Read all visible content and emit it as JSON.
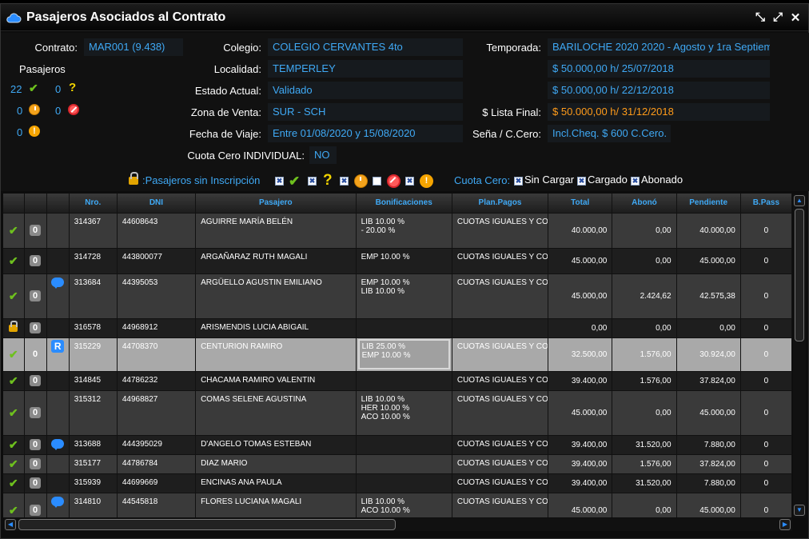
{
  "window": {
    "title": "Pasajeros Asociados al Contrato"
  },
  "info": {
    "contrato_label": "Contrato:",
    "contrato": "MAR001 (9.438)",
    "colegio_label": "Colegio:",
    "colegio": "COLEGIO CERVANTES 4to",
    "localidad_label": "Localidad:",
    "localidad": "TEMPERLEY",
    "estado_label": "Estado Actual:",
    "estado": "Validado",
    "zona_label": "Zona de Venta:",
    "zona": "SUR - SCH",
    "fecha_label": "Fecha de Viaje:",
    "fecha": "Entre 01/08/2020 y 15/08/2020",
    "cuota_label": "Cuota Cero INDIVIDUAL:",
    "cuota": "NO",
    "temporada_label": "Temporada:",
    "temporada": "BARILOCHE 2020 2020 - Agosto y 1ra Septiem",
    "precio1": "$ 50.000,00 h/ 25/07/2018",
    "precio2": "$ 50.000,00 h/ 22/12/2018",
    "lista_label": "$ Lista Final:",
    "lista": "$ 50.000,00 h/ 31/12/2018",
    "sena_label": "Seña / C.Cero:",
    "sena": "Incl.Cheq. $ 600 C.Cero."
  },
  "pasajeros": {
    "label": "Pasajeros",
    "ok": "22",
    "pending": "0",
    "clock": "0",
    "banned": "0",
    "warn": "0"
  },
  "legend": {
    "sin_inscripcion": ":Pasajeros sin Inscripción",
    "cuota_cero": "Cuota Cero:",
    "sin_cargar": "Sin Cargar",
    "cargado": "Cargado",
    "abonado": "Abonado"
  },
  "columns": [
    "",
    "",
    "",
    "Nro.",
    "DNI",
    "Pasajero",
    "Bonificaciones",
    "Plan.Pagos",
    "Total",
    "Abonó",
    "Pendiente",
    "B.Pass"
  ],
  "rows": [
    {
      "status": "check",
      "badge": "0",
      "extra": "",
      "nro": "314367",
      "dni": "44608643",
      "nombre": "AGUIRRE MARÍA BELÉN",
      "bonif": [
        "LIB 10.00 %",
        "- 20.00 %"
      ],
      "plan": "CUOTAS IGUALES Y COI",
      "total": "40.000,00",
      "abono": "0,00",
      "pend": "40.000,00",
      "bpass": "0"
    },
    {
      "status": "check",
      "badge": "0",
      "extra": "",
      "nro": "314728",
      "dni": "443800077",
      "nombre": "ARGAÑARAZ RUTH MAGALI",
      "bonif": [
        "EMP 10.00 %"
      ],
      "plan": "CUOTAS IGUALES Y COI",
      "total": "45.000,00",
      "abono": "0,00",
      "pend": "45.000,00",
      "bpass": "0"
    },
    {
      "status": "check",
      "badge": "0",
      "extra": "bubble",
      "nro": "313684",
      "dni": "44395053",
      "nombre": "ARGÜELLO AGUSTIN EMILIANO",
      "bonif": [
        "EMP 10.00 %",
        "LIB 10.00 %"
      ],
      "plan": "CUOTAS IGUALES Y COI",
      "total": "45.000,00",
      "abono": "2.424,62",
      "pend": "42.575,38",
      "bpass": "0"
    },
    {
      "status": "lock",
      "badge": "0",
      "extra": "",
      "nro": "316578",
      "dni": "44968912",
      "nombre": "ARISMENDIS LUCIA ABIGAIL",
      "bonif": [],
      "plan": "",
      "total": "0,00",
      "abono": "0,00",
      "pend": "0,00",
      "bpass": "0"
    },
    {
      "status": "check",
      "badge": "0",
      "extra": "R",
      "nro": "315229",
      "dni": "44708370",
      "nombre": "CENTURION RAMIRO",
      "bonif": [
        "LIB 25.00 %",
        "EMP 10.00 %"
      ],
      "plan": "CUOTAS IGUALES Y COI",
      "total": "32.500,00",
      "abono": "1.576,00",
      "pend": "30.924,00",
      "bpass": "0"
    },
    {
      "status": "check",
      "badge": "0",
      "extra": "",
      "nro": "314845",
      "dni": "44786232",
      "nombre": "CHACAMA RAMIRO VALENTIN",
      "bonif": [],
      "plan": "CUOTAS IGUALES Y COI",
      "total": "39.400,00",
      "abono": "1.576,00",
      "pend": "37.824,00",
      "bpass": "0"
    },
    {
      "status": "check",
      "badge": "0",
      "extra": "",
      "nro": "315312",
      "dni": "44968827",
      "nombre": "COMAS SELENE AGUSTINA",
      "bonif": [
        "LIB 10.00 %",
        "HER 10.00 %",
        "ACO 10.00 %"
      ],
      "plan": "CUOTAS IGUALES Y COI",
      "total": "45.000,00",
      "abono": "0,00",
      "pend": "45.000,00",
      "bpass": "0"
    },
    {
      "status": "check",
      "badge": "0",
      "extra": "bubble",
      "nro": "313688",
      "dni": "444395029",
      "nombre": "D'ANGELO TOMAS ESTEBAN",
      "bonif": [],
      "plan": "CUOTAS IGUALES Y COI",
      "total": "39.400,00",
      "abono": "31.520,00",
      "pend": "7.880,00",
      "bpass": "0"
    },
    {
      "status": "check",
      "badge": "0",
      "extra": "",
      "nro": "315177",
      "dni": "44786784",
      "nombre": "DIAZ MARIO",
      "bonif": [],
      "plan": "CUOTAS IGUALES Y COI",
      "total": "39.400,00",
      "abono": "1.576,00",
      "pend": "37.824,00",
      "bpass": "0"
    },
    {
      "status": "check",
      "badge": "0",
      "extra": "",
      "nro": "315939",
      "dni": "44699669",
      "nombre": "ENCINAS ANA PAULA",
      "bonif": [],
      "plan": "CUOTAS IGUALES Y COI",
      "total": "39.400,00",
      "abono": "31.520,00",
      "pend": "7.880,00",
      "bpass": "0"
    },
    {
      "status": "check",
      "badge": "0",
      "extra": "bubble",
      "nro": "314810",
      "dni": "44545818",
      "nombre": "FLORES LUCIANA MAGALI",
      "bonif": [
        "LIB 10.00 %",
        "ACO 10.00 %"
      ],
      "plan": "CUOTAS IGUALES Y COI",
      "total": "45.000,00",
      "abono": "0,00",
      "pend": "45.000,00",
      "bpass": "0"
    }
  ]
}
